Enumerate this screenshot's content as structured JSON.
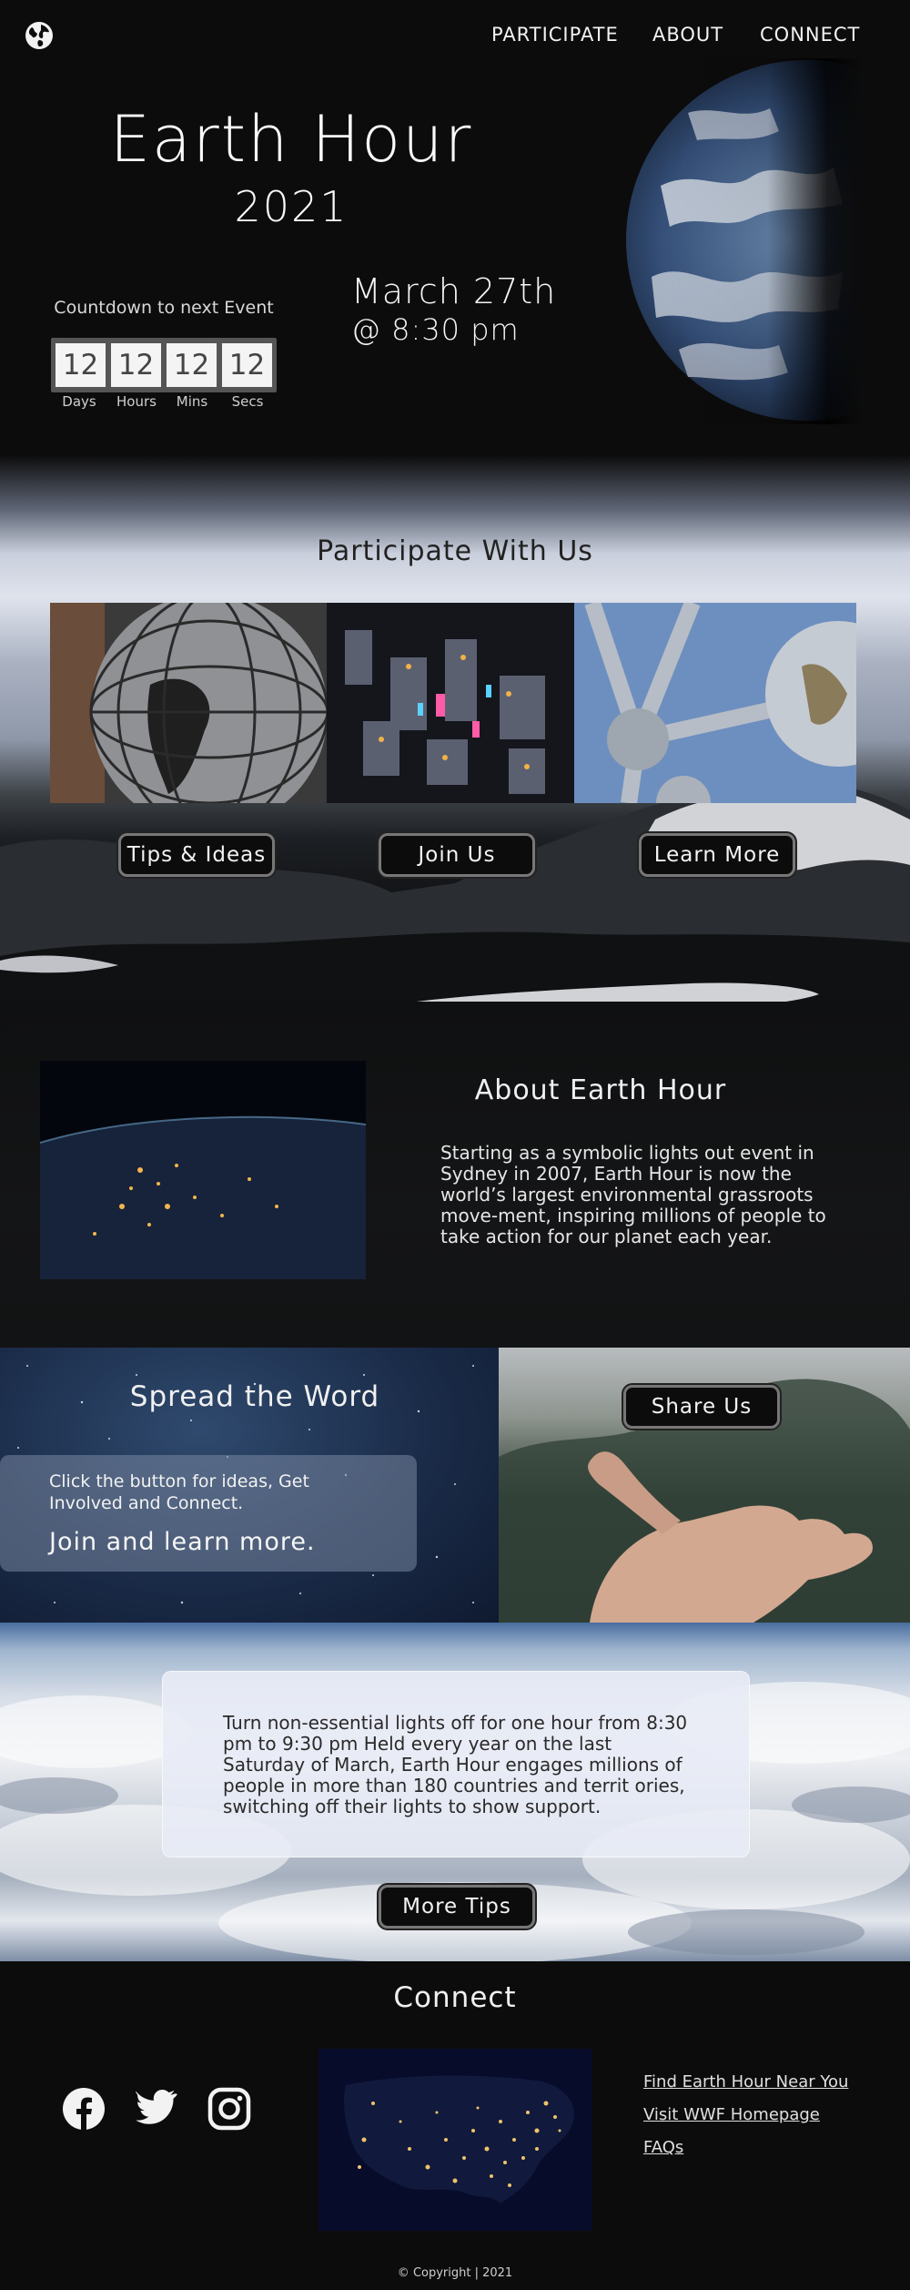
{
  "nav": {
    "items": [
      "PARTICIPATE",
      "ABOUT",
      "CONNECT"
    ]
  },
  "hero": {
    "title": "Earth Hour",
    "year": "2021",
    "countdown_label": "Countdown to next Event",
    "countdown": {
      "days": "12",
      "hours": "12",
      "mins": "12",
      "secs": "12"
    },
    "units": {
      "days": "Days",
      "hours": "Hours",
      "mins": "Mins",
      "secs": "Secs"
    },
    "date": "March 27th",
    "time": "@ 8:30 pm"
  },
  "participate": {
    "title": "Participate With Us",
    "buttons": [
      "Tips & Ideas",
      "Join Us",
      "Learn More"
    ]
  },
  "about": {
    "title": "About Earth Hour",
    "text": "Starting as a symbolic lights out event in Sydney in 2007, Earth Hour is now the world’s largest environmental grassroots move-ment, inspiring millions of people to take action for our planet each year."
  },
  "spread": {
    "title": "Spread the Word",
    "small_text": "Click the button for ideas, Get Involved and Connect.",
    "big_text": "Join and learn more.",
    "share_button": "Share Us"
  },
  "clouds": {
    "text": "Turn non-essential lights off for one hour from 8:30 pm to 9:30 pm Held every year on the last Saturday of March, Earth Hour engages millions of people in more than 180 countries and territ ories, switching off their lights to show support.",
    "button": "More Tips"
  },
  "connect": {
    "title": "Connect",
    "social_icons": [
      "facebook-icon",
      "twitter-icon",
      "instagram-icon"
    ],
    "links": [
      "Find Earth Hour Near You",
      "Visit WWF Homepage",
      "FAQs"
    ],
    "copyright": "Copyright | 2021"
  },
  "colors": {
    "background": "#0c0c0c",
    "button_bg": "#0c0c0c",
    "button_border": "#777777"
  }
}
